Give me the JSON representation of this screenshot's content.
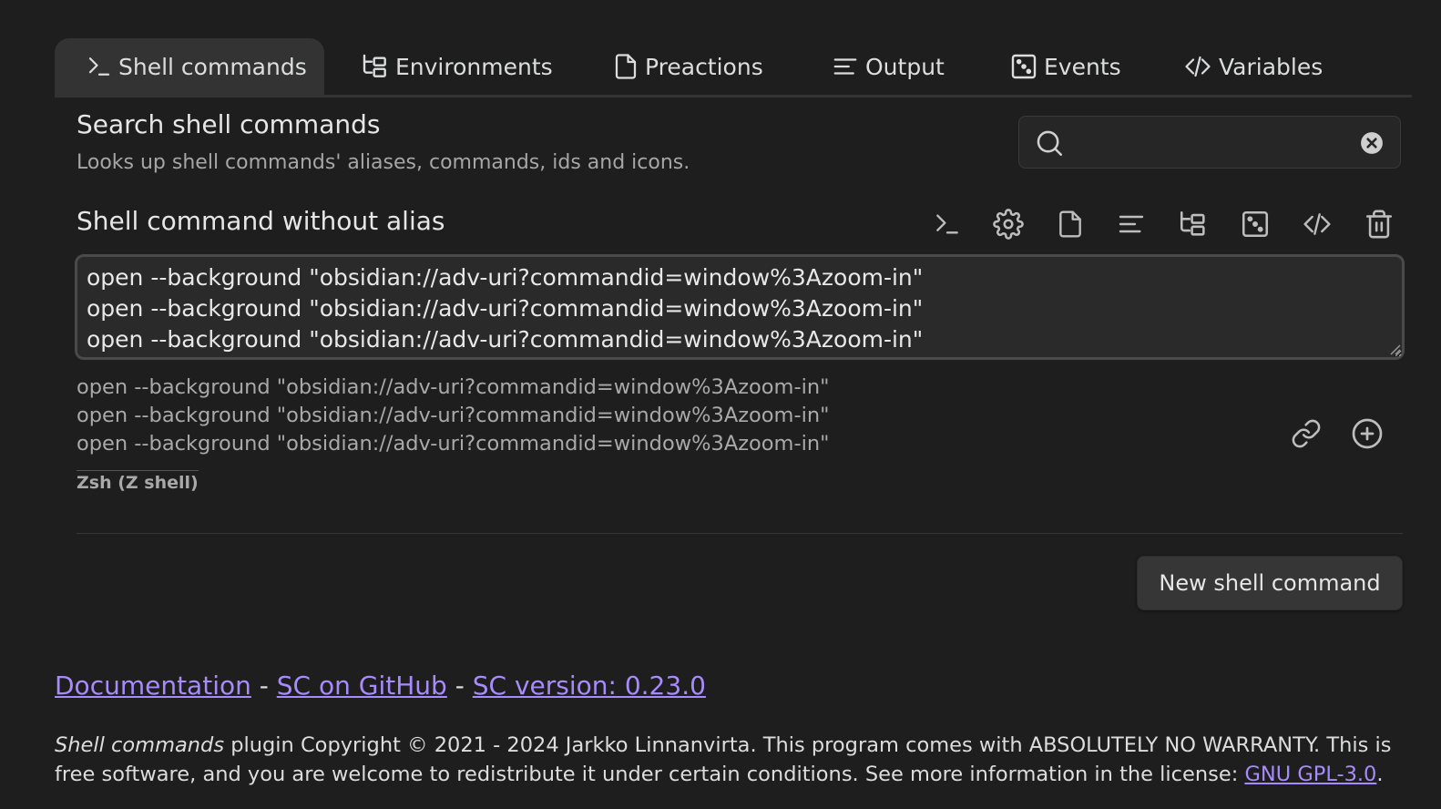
{
  "tabs": [
    {
      "label": "Shell commands",
      "icon": "terminal-icon",
      "active": true
    },
    {
      "label": "Environments",
      "icon": "folder-tree-icon",
      "active": false
    },
    {
      "label": "Preactions",
      "icon": "file-icon",
      "active": false
    },
    {
      "label": "Output",
      "icon": "align-left-icon",
      "active": false
    },
    {
      "label": "Events",
      "icon": "dice-icon",
      "active": false
    },
    {
      "label": "Variables",
      "icon": "code-icon",
      "active": false
    }
  ],
  "search": {
    "title": "Search shell commands",
    "description": "Looks up shell commands' aliases, commands, ids and icons.",
    "value": "",
    "placeholder": ""
  },
  "command": {
    "title": "Shell command without alias",
    "text": "open --background \"obsidian://adv-uri?commandid=window%3Azoom-in\"\nopen --background \"obsidian://adv-uri?commandid=window%3Azoom-in\"\nopen --background \"obsidian://adv-uri?commandid=window%3Azoom-in\"",
    "preview_lines": [
      "open --background \"obsidian://adv-uri?commandid=window%3Azoom-in\"",
      "open --background \"obsidian://adv-uri?commandid=window%3Azoom-in\"",
      "open --background \"obsidian://adv-uri?commandid=window%3Azoom-in\""
    ],
    "shell": "Zsh (Z shell)",
    "toolbar_icons": [
      "terminal-icon",
      "gear-icon",
      "file-icon",
      "align-left-icon",
      "folder-tree-icon",
      "dice-icon",
      "code-icon",
      "trash-icon"
    ]
  },
  "new_button": "New shell command",
  "links": {
    "documentation": "Documentation",
    "github": "SC on GitHub",
    "version": "SC version: 0.23.0",
    "separator": "-"
  },
  "footer": {
    "plugin_name": "Shell commands",
    "text": " plugin Copyright © 2021 - 2024 Jarkko Linnanvirta. This program comes with ABSOLUTELY NO WARRANTY. This is free software, and you are welcome to redistribute it under certain conditions. See more information in the license: ",
    "license_link": "GNU GPL-3.0",
    "end": "."
  },
  "colors": {
    "background": "#1e1e1e",
    "accent_link": "#a78bfa",
    "active_tab": "#333333"
  }
}
